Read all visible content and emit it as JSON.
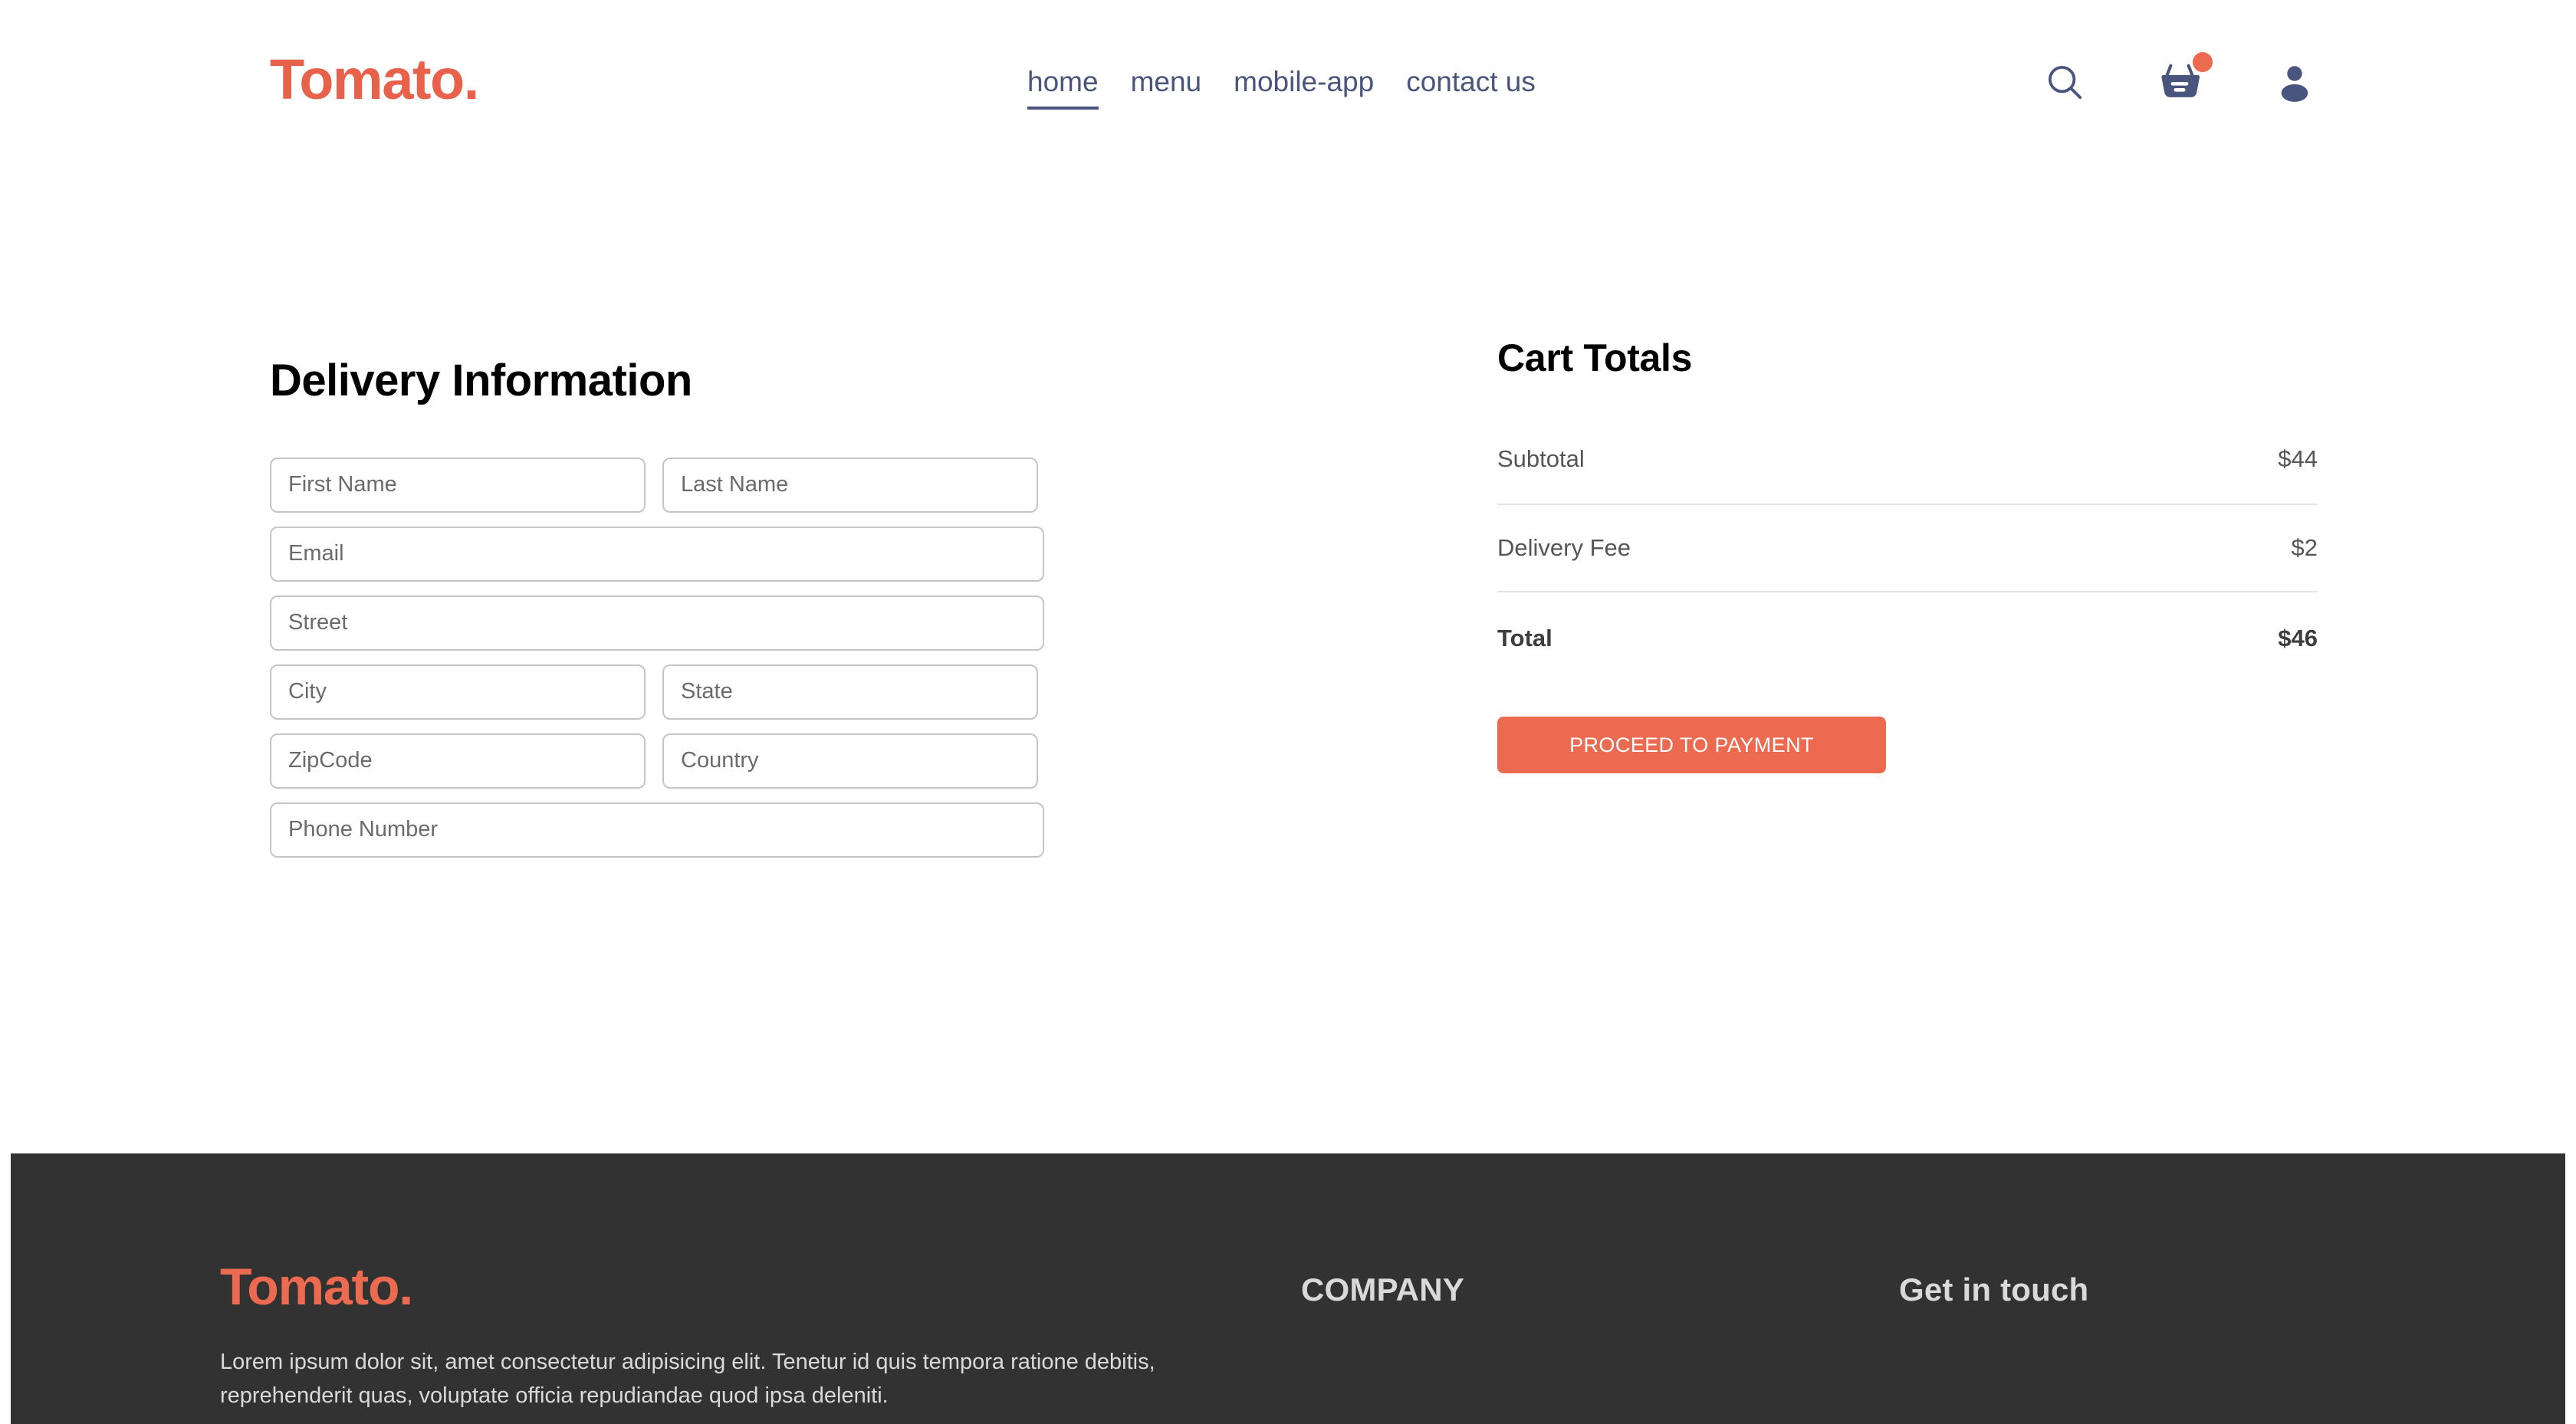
{
  "brand": {
    "name": "Tomato."
  },
  "nav": {
    "items": [
      {
        "label": "home",
        "active": true
      },
      {
        "label": "menu",
        "active": false
      },
      {
        "label": "mobile-app",
        "active": false
      },
      {
        "label": "contact us",
        "active": false
      }
    ],
    "icons": {
      "search": "search-icon",
      "cart": "basket-icon",
      "profile": "profile-icon"
    },
    "cart_badge": ""
  },
  "delivery": {
    "title": "Delivery Information",
    "fields": {
      "first_name": {
        "placeholder": "First Name",
        "value": ""
      },
      "last_name": {
        "placeholder": "Last Name",
        "value": ""
      },
      "email": {
        "placeholder": "Email",
        "value": ""
      },
      "street": {
        "placeholder": "Street",
        "value": ""
      },
      "city": {
        "placeholder": "City",
        "value": ""
      },
      "state": {
        "placeholder": "State",
        "value": ""
      },
      "zipcode": {
        "placeholder": "ZipCode",
        "value": ""
      },
      "country": {
        "placeholder": "Country",
        "value": ""
      },
      "phone": {
        "placeholder": "Phone Number",
        "value": ""
      }
    }
  },
  "cart": {
    "title": "Cart Totals",
    "rows": [
      {
        "label": "Subtotal",
        "value": "$44"
      },
      {
        "label": "Delivery Fee",
        "value": "$2"
      },
      {
        "label": "Total",
        "value": "$46"
      }
    ],
    "pay_button": "PROCEED TO PAYMENT"
  },
  "footer": {
    "logo": "Tomato.",
    "description": "Lorem ipsum dolor sit, amet consectetur adipisicing elit. Tenetur id quis tempora ratione debitis, reprehenderit quas, voluptate officia repudiandae quod ipsa deleniti.",
    "company_heading": "COMPANY",
    "touch_heading": "Get in touch"
  },
  "colors": {
    "accent": "#ec6a4f",
    "nav_text": "#49557e",
    "footer_bg": "#323232",
    "field_border": "#c5c5c5",
    "divider": "#e4e4e4"
  }
}
